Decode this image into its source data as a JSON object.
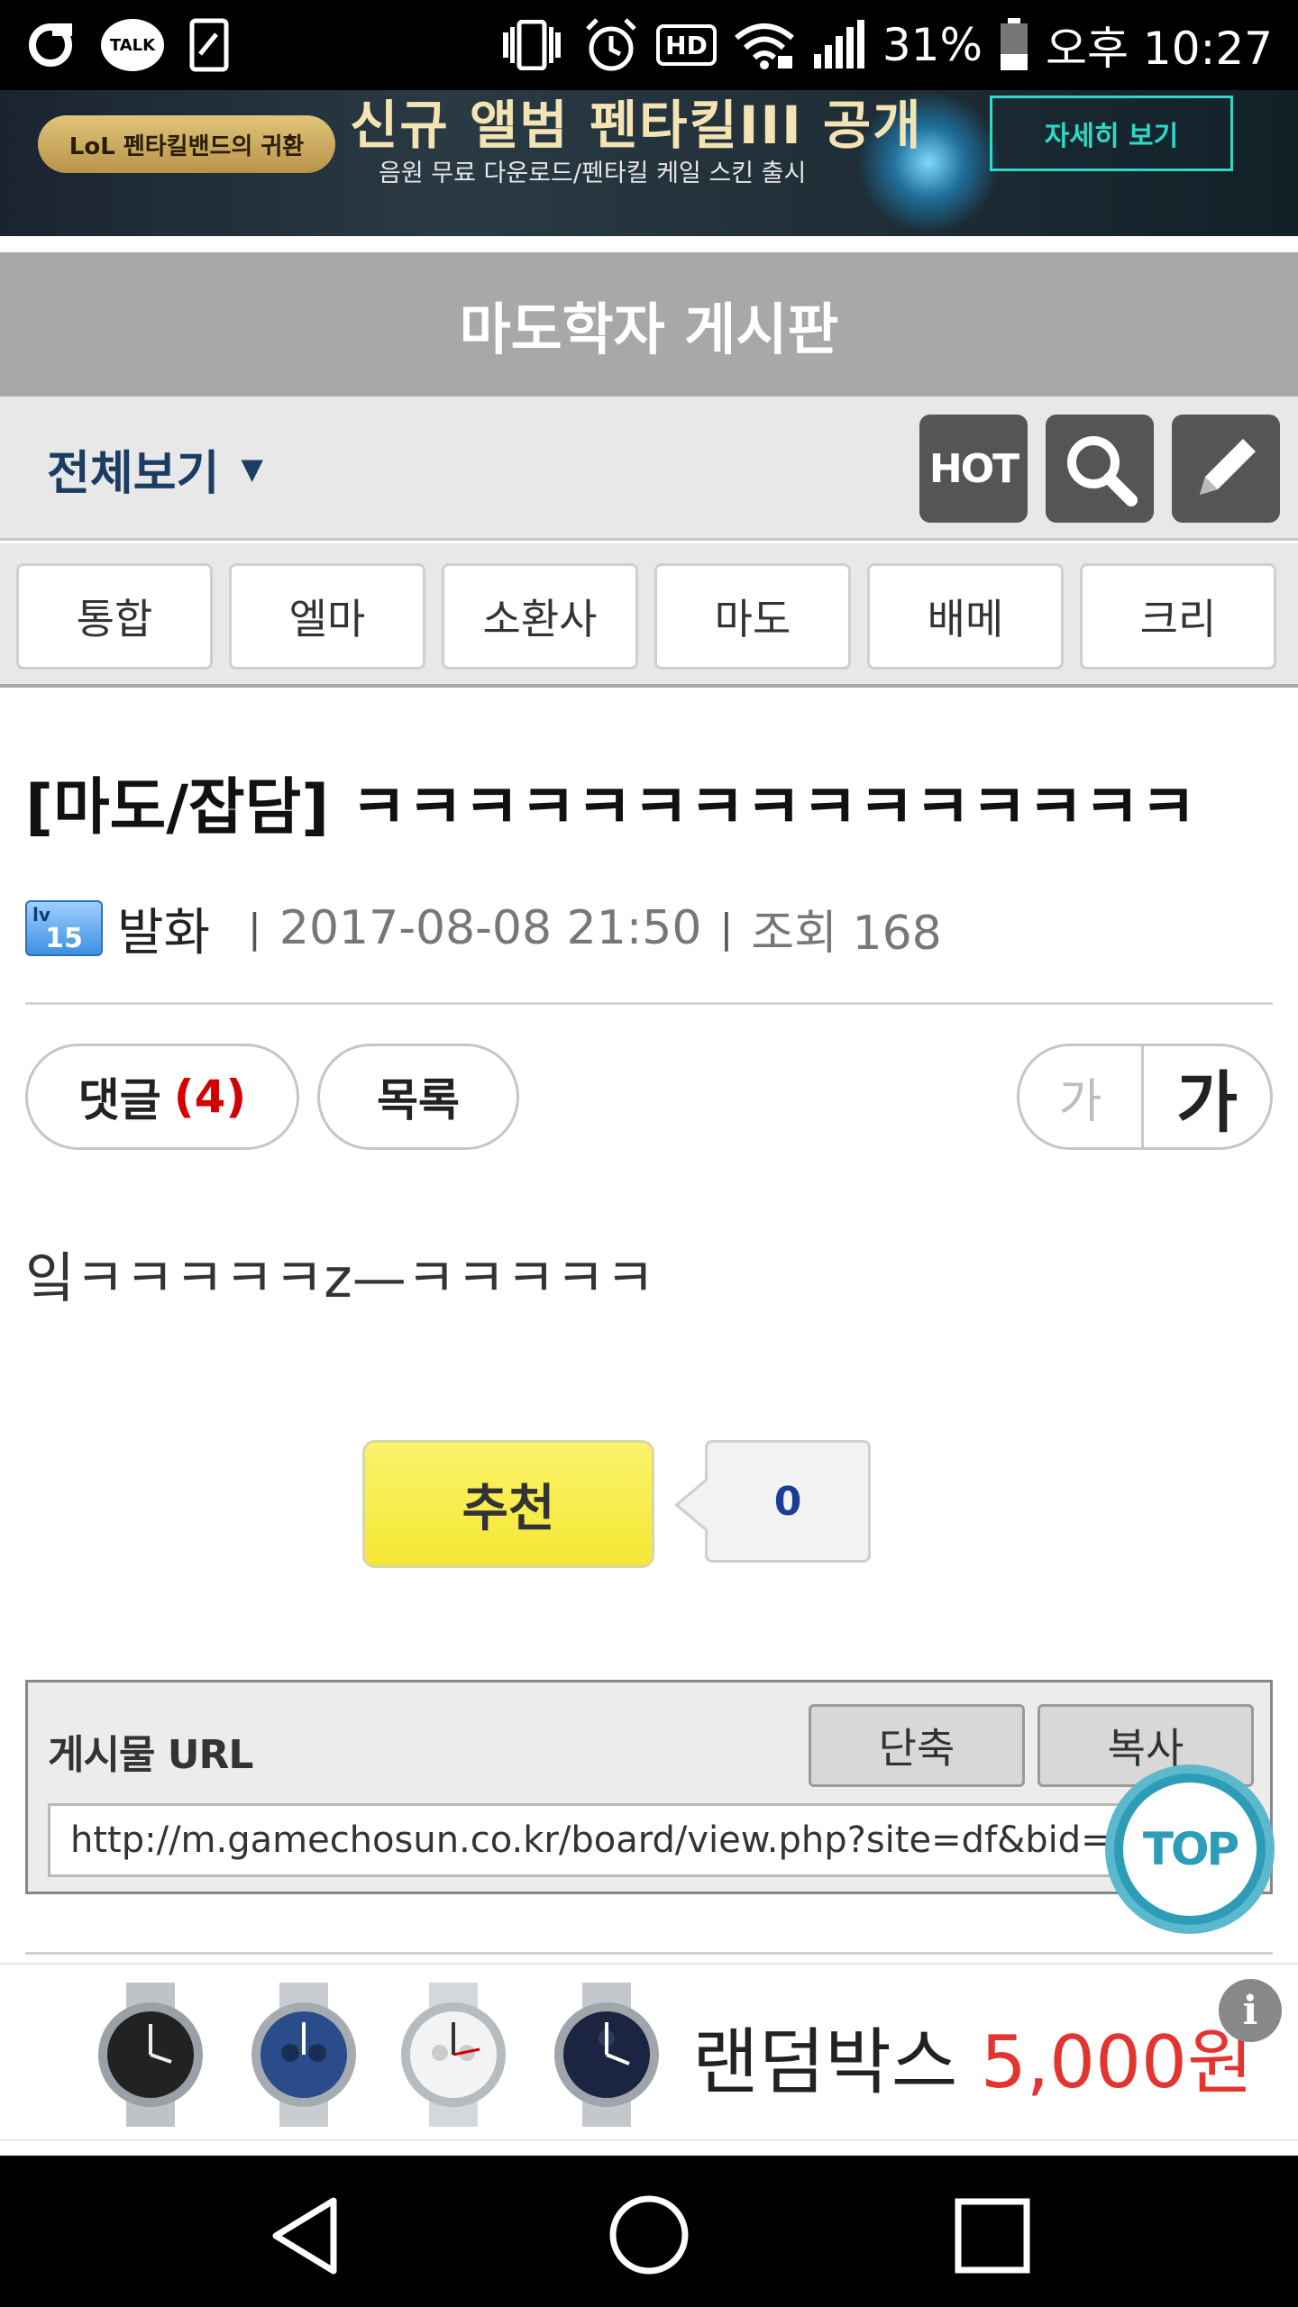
{
  "status_bar": {
    "battery_percent": "31%",
    "time": "오후 10:27",
    "left_icons": [
      "olleh-icon",
      "kakaotalk-icon",
      "screenshot-icon"
    ],
    "kakao_label": "TALK",
    "hd_label": "HD",
    "right_icons": [
      "vibrate-icon",
      "alarm-icon",
      "hd-voice-icon",
      "wifi-icon",
      "signal-icon",
      "battery-icon"
    ]
  },
  "top_banner": {
    "pill_text": "LoL 펜타킬밴드의 귀환",
    "headline": "신규 앨범 펜타킬III 공개",
    "subtitle": "음원 무료 다운로드/펜타킬 케일 스킨 출시",
    "cta": "자세히 보기"
  },
  "board": {
    "title": "마도학자 게시판",
    "view_all_label": "전체보기",
    "hot_label": "HOT",
    "categories": [
      "통합",
      "엘마",
      "소환사",
      "마도",
      "배메",
      "크리"
    ]
  },
  "post": {
    "title": "[마도/잡담] ㅋㅋㅋㅋㅋㅋㅋㅋㅋㅋㅋㅋㅋㅋㅋ",
    "level_badge": "15",
    "level_prefix": "lv",
    "author": "발화",
    "datetime": "2017-08-08 21:50",
    "views_label": "조회 168",
    "comment_label": "댓글",
    "comment_count": "(4)",
    "list_label": "목록",
    "font_small": "가",
    "font_large": "가",
    "body": "잌ㅋㅋㅋㅋㅋz—ㅋㅋㅋㅋㅋ",
    "recommend_label": "추천",
    "recommend_count": "0"
  },
  "url_box": {
    "label": "게시물 URL",
    "shorten_label": "단축",
    "copy_label": "복사",
    "url": "http://m.gamechosun.co.kr/board/view.php?site=df&bid=job8_38"
  },
  "top_button": "TOP",
  "bottom_ad": {
    "text": "랜덤박스",
    "price": "5,000원",
    "info": "i"
  },
  "colors": {
    "board_header": "#a8a8a8",
    "view_all": "#1c3d63",
    "comment_count": "#d40000",
    "recommend": "#f5e734",
    "top_button": "#2d9db7",
    "ad_price": "#e3342f"
  }
}
